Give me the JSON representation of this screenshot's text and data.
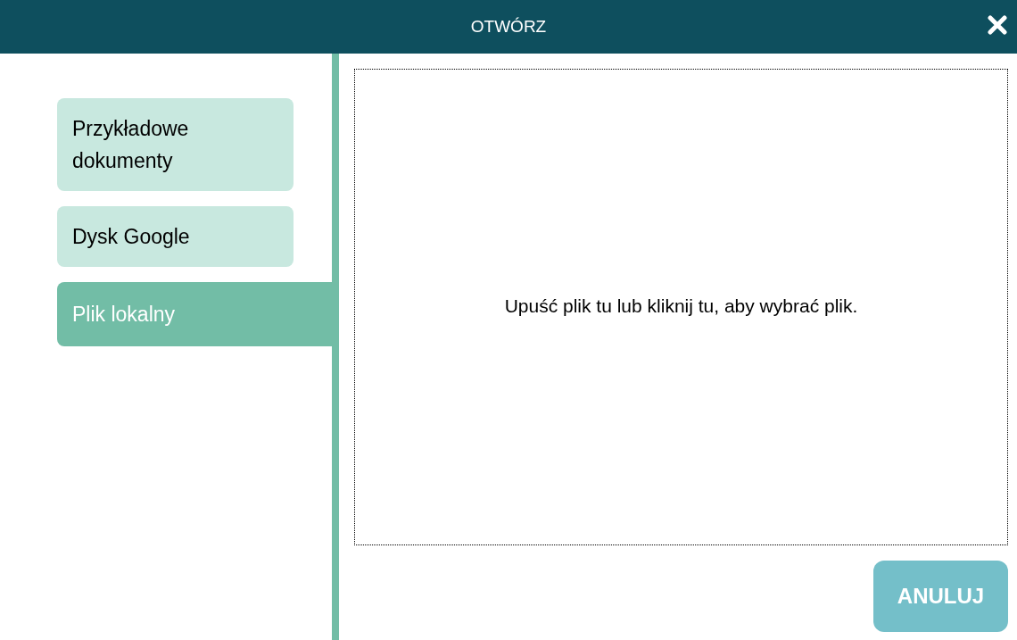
{
  "window": {
    "title": "OTWÓRZ"
  },
  "tabs": [
    {
      "label": "Przykładowe dokumenty",
      "selected": false
    },
    {
      "label": "Dysk Google",
      "selected": false
    },
    {
      "label": "Plik lokalny",
      "selected": true
    }
  ],
  "drop_zone": {
    "text": "Upuść plik tu lub kliknij tu, aby wybrać plik."
  },
  "buttons": [
    "ANULUJ"
  ]
}
